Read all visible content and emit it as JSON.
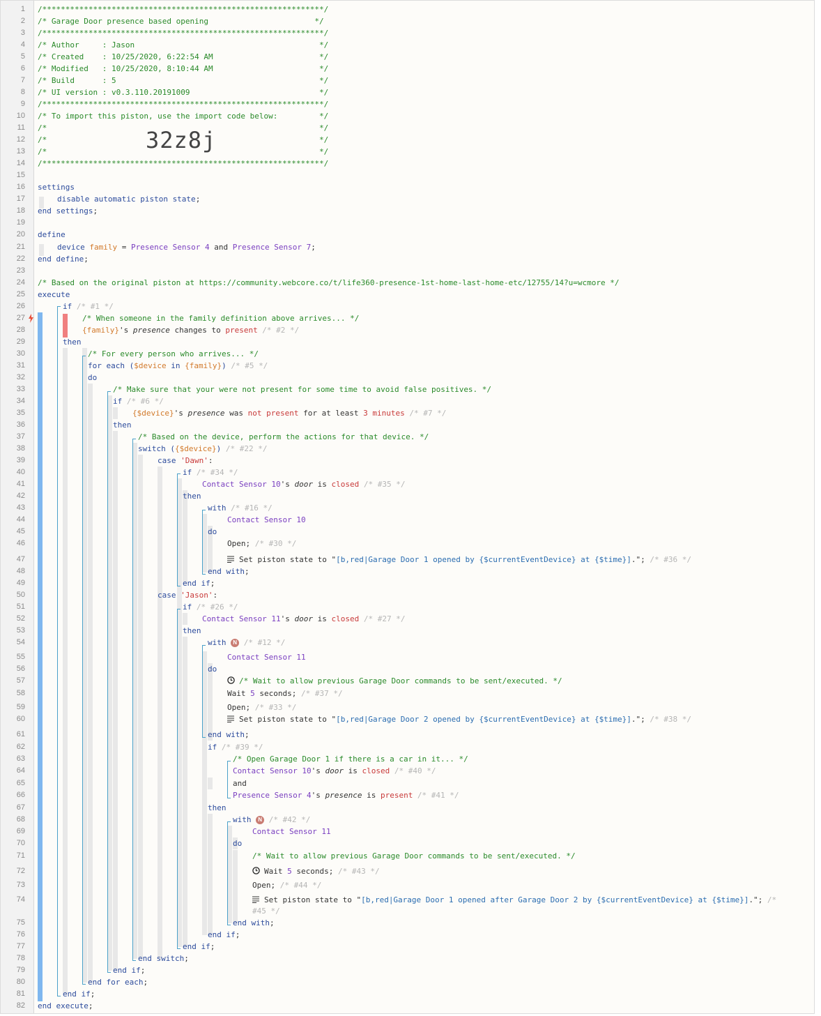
{
  "piston": {
    "title": "Garage Door presence based opening",
    "author": "Jason",
    "created": "10/25/2020, 6:22:54 AM",
    "modified": "10/25/2020, 8:10:44 AM",
    "build": "5",
    "ui_version": "v0.3.110.20191009",
    "import_code": "32z8j"
  },
  "icons": {
    "trigger": "lightning-bolt-icon",
    "wait": "clock-icon",
    "set_state": "list-icon",
    "with_badge": "n-badge-icon"
  },
  "colors": {
    "comment": "#2a8a2a",
    "keyword": "#2c4b9c",
    "device": "#7a3fc0",
    "variable": "#d27a2c",
    "string": "#2a6cb0",
    "value_red": "#c83a3a",
    "block_bar": "#7fb7ef",
    "trigger_bar": "#f08080"
  },
  "lines": [
    {
      "n": "1",
      "parts": [
        {
          "t": "/*************************************************************/",
          "c": "cmt"
        }
      ]
    },
    {
      "n": "2",
      "parts": [
        {
          "t": "/* Garage Door presence based opening                       */",
          "c": "cmt"
        }
      ]
    },
    {
      "n": "3",
      "parts": [
        {
          "t": "/*************************************************************/",
          "c": "cmt"
        }
      ]
    },
    {
      "n": "4",
      "parts": [
        {
          "t": "/* Author     : Jason                                        */",
          "c": "cmt"
        }
      ]
    },
    {
      "n": "5",
      "parts": [
        {
          "t": "/* Created    : 10/25/2020, 6:22:54 AM                       */",
          "c": "cmt"
        }
      ]
    },
    {
      "n": "6",
      "parts": [
        {
          "t": "/* Modified   : 10/25/2020, 8:10:44 AM                       */",
          "c": "cmt"
        }
      ]
    },
    {
      "n": "7",
      "parts": [
        {
          "t": "/* Build      : 5                                            */",
          "c": "cmt"
        }
      ]
    },
    {
      "n": "8",
      "parts": [
        {
          "t": "/* UI version : v0.3.110.20191009                            */",
          "c": "cmt"
        }
      ]
    },
    {
      "n": "9",
      "parts": [
        {
          "t": "/*************************************************************/",
          "c": "cmt"
        }
      ]
    },
    {
      "n": "10",
      "parts": [
        {
          "t": "/* To import this piston, use the import code below:         */",
          "c": "cmt"
        }
      ]
    },
    {
      "n": "11",
      "parts": [
        {
          "t": "/*                                                           */",
          "c": "cmt"
        }
      ]
    },
    {
      "n": "12",
      "parts": [
        {
          "t": "/*                                                           */",
          "c": "cmt"
        }
      ]
    },
    {
      "n": "13",
      "parts": [
        {
          "t": "/*                                                           */",
          "c": "cmt"
        }
      ]
    },
    {
      "n": "14",
      "parts": [
        {
          "t": "/*************************************************************/",
          "c": "cmt"
        }
      ]
    },
    {
      "n": "15",
      "parts": []
    },
    {
      "n": "16",
      "parts": [
        {
          "t": "settings",
          "c": "kw"
        }
      ]
    },
    {
      "n": "17",
      "parts": [
        {
          "t": "disable automatic piston state",
          "c": "kw"
        },
        {
          "t": ";",
          "c": "pl"
        }
      ]
    },
    {
      "n": "18",
      "parts": [
        {
          "t": "end settings",
          "c": "kw"
        },
        {
          "t": ";",
          "c": "pl"
        }
      ]
    },
    {
      "n": "19",
      "parts": []
    },
    {
      "n": "20",
      "parts": [
        {
          "t": "define",
          "c": "kw"
        }
      ]
    },
    {
      "n": "21",
      "parts": [
        {
          "t": "device ",
          "c": "kw"
        },
        {
          "t": "family",
          "c": "var"
        },
        {
          "t": " = ",
          "c": "pl"
        },
        {
          "t": "Presence Sensor 4",
          "c": "dev"
        },
        {
          "t": " and ",
          "c": "pl"
        },
        {
          "t": "Presence Sensor 7",
          "c": "dev"
        },
        {
          "t": ";",
          "c": "pl"
        }
      ]
    },
    {
      "n": "22",
      "parts": [
        {
          "t": "end define",
          "c": "kw"
        },
        {
          "t": ";",
          "c": "pl"
        }
      ]
    },
    {
      "n": "23",
      "parts": []
    },
    {
      "n": "24",
      "parts": [
        {
          "t": "/* Based on the original piston at https://community.webcore.co/t/life360-presence-1st-home-last-home-etc/12755/14?u=wcmore */",
          "c": "cmt"
        }
      ]
    },
    {
      "n": "25",
      "parts": [
        {
          "t": "execute",
          "c": "kw"
        }
      ]
    },
    {
      "n": "26",
      "parts": [
        {
          "t": "if ",
          "c": "kw"
        },
        {
          "t": "/* #1 */",
          "c": "dim"
        }
      ]
    },
    {
      "n": "27",
      "parts": [
        {
          "t": "/* When someone in the family definition above arrives... */",
          "c": "cmt"
        }
      ]
    },
    {
      "n": "28",
      "parts": [
        {
          "t": "{family}",
          "c": "var"
        },
        {
          "t": "'s ",
          "c": "pl"
        },
        {
          "t": "presence",
          "c": "pl it"
        },
        {
          "t": " changes to ",
          "c": "pl"
        },
        {
          "t": "present",
          "c": "red"
        },
        {
          "t": " /* #2 */",
          "c": "dim"
        }
      ]
    },
    {
      "n": "29",
      "parts": [
        {
          "t": "then",
          "c": "kw"
        }
      ]
    },
    {
      "n": "30",
      "parts": [
        {
          "t": "/* For every person who arrives... */",
          "c": "cmt"
        }
      ]
    },
    {
      "n": "31",
      "parts": [
        {
          "t": "for each (",
          "c": "kw"
        },
        {
          "t": "$device",
          "c": "var"
        },
        {
          "t": " in ",
          "c": "kw"
        },
        {
          "t": "{family}",
          "c": "var"
        },
        {
          "t": ") ",
          "c": "kw"
        },
        {
          "t": "/* #5 */",
          "c": "dim"
        }
      ]
    },
    {
      "n": "32",
      "parts": [
        {
          "t": "do",
          "c": "kw"
        }
      ]
    },
    {
      "n": "33",
      "parts": [
        {
          "t": "/* Make sure that your were not present for some time to avoid false positives. */",
          "c": "cmt"
        }
      ]
    },
    {
      "n": "34",
      "parts": [
        {
          "t": "if ",
          "c": "kw"
        },
        {
          "t": "/* #6 */",
          "c": "dim"
        }
      ]
    },
    {
      "n": "35",
      "parts": [
        {
          "t": "{$device}",
          "c": "var"
        },
        {
          "t": "'s ",
          "c": "pl"
        },
        {
          "t": "presence",
          "c": "pl it"
        },
        {
          "t": " was ",
          "c": "pl"
        },
        {
          "t": "not present",
          "c": "red"
        },
        {
          "t": " for at least ",
          "c": "pl"
        },
        {
          "t": "3 minutes",
          "c": "red"
        },
        {
          "t": " /* #7 */",
          "c": "dim"
        }
      ]
    },
    {
      "n": "36",
      "parts": [
        {
          "t": "then",
          "c": "kw"
        }
      ]
    },
    {
      "n": "37",
      "parts": [
        {
          "t": "/* Based on the device, perform the actions for that device. */",
          "c": "cmt"
        }
      ]
    },
    {
      "n": "38",
      "parts": [
        {
          "t": "switch (",
          "c": "kw"
        },
        {
          "t": "{$device}",
          "c": "var"
        },
        {
          "t": ") ",
          "c": "kw"
        },
        {
          "t": "/* #22 */",
          "c": "dim"
        }
      ]
    },
    {
      "n": "39",
      "parts": [
        {
          "t": "case ",
          "c": "kw"
        },
        {
          "t": "'Dawn'",
          "c": "red"
        },
        {
          "t": ":",
          "c": "pl"
        }
      ]
    },
    {
      "n": "40",
      "parts": [
        {
          "t": "if ",
          "c": "kw"
        },
        {
          "t": "/* #34 */",
          "c": "dim"
        }
      ]
    },
    {
      "n": "41",
      "parts": [
        {
          "t": "Contact Sensor 10",
          "c": "dev"
        },
        {
          "t": "'s ",
          "c": "pl"
        },
        {
          "t": "door",
          "c": "pl it"
        },
        {
          "t": " is ",
          "c": "pl"
        },
        {
          "t": "closed",
          "c": "red"
        },
        {
          "t": " /* #35 */",
          "c": "dim"
        }
      ]
    },
    {
      "n": "42",
      "parts": [
        {
          "t": "then",
          "c": "kw"
        }
      ]
    },
    {
      "n": "43",
      "parts": [
        {
          "t": "with ",
          "c": "kw"
        },
        {
          "t": "/* #16 */",
          "c": "dim"
        }
      ]
    },
    {
      "n": "44",
      "parts": [
        {
          "t": "Contact Sensor 10",
          "c": "dev"
        }
      ]
    },
    {
      "n": "45",
      "parts": [
        {
          "t": "do",
          "c": "kw"
        }
      ]
    },
    {
      "n": "46",
      "parts": [
        {
          "t": "Open; ",
          "c": "pl"
        },
        {
          "t": "/* #30 */",
          "c": "dim"
        }
      ]
    },
    {
      "n": "47",
      "parts": [
        {
          "t": "Set piston state to \"",
          "c": "pl"
        },
        {
          "t": "[b,red|Garage Door 1 opened by {$currentEventDevice} at {$time}]",
          "c": "str"
        },
        {
          "t": ".\"; ",
          "c": "pl"
        },
        {
          "t": "/* #36 */",
          "c": "dim"
        }
      ]
    },
    {
      "n": "48",
      "parts": [
        {
          "t": "end with",
          "c": "kw"
        },
        {
          "t": ";",
          "c": "pl"
        }
      ]
    },
    {
      "n": "49",
      "parts": [
        {
          "t": "end if",
          "c": "kw"
        },
        {
          "t": ";",
          "c": "pl"
        }
      ]
    },
    {
      "n": "50",
      "parts": [
        {
          "t": "case ",
          "c": "kw"
        },
        {
          "t": "'Jason'",
          "c": "red"
        },
        {
          "t": ":",
          "c": "pl"
        }
      ]
    },
    {
      "n": "51",
      "parts": [
        {
          "t": "if ",
          "c": "kw"
        },
        {
          "t": "/* #26 */",
          "c": "dim"
        }
      ]
    },
    {
      "n": "52",
      "parts": [
        {
          "t": "Contact Sensor 11",
          "c": "dev"
        },
        {
          "t": "'s ",
          "c": "pl"
        },
        {
          "t": "door",
          "c": "pl it"
        },
        {
          "t": " is ",
          "c": "pl"
        },
        {
          "t": "closed",
          "c": "red"
        },
        {
          "t": " /* #27 */",
          "c": "dim"
        }
      ]
    },
    {
      "n": "53",
      "parts": [
        {
          "t": "then",
          "c": "kw"
        }
      ]
    },
    {
      "n": "54",
      "parts": [
        {
          "t": "with ",
          "c": "kw"
        },
        {
          "t": "N",
          "c": "badge"
        },
        {
          "t": " /* #12 */",
          "c": "dim"
        }
      ]
    },
    {
      "n": "55",
      "parts": [
        {
          "t": "Contact Sensor 11",
          "c": "dev"
        }
      ]
    },
    {
      "n": "56",
      "parts": [
        {
          "t": "do",
          "c": "kw"
        }
      ]
    },
    {
      "n": "57",
      "parts": [
        {
          "t": "/* Wait to allow previous Garage Door commands to be sent/executed. */",
          "c": "cmt"
        }
      ]
    },
    {
      "n": "58",
      "parts": [
        {
          "t": "Wait ",
          "c": "pl"
        },
        {
          "t": "5",
          "c": "num"
        },
        {
          "t": " seconds; ",
          "c": "pl"
        },
        {
          "t": "/* #37 */",
          "c": "dim"
        }
      ]
    },
    {
      "n": "59",
      "parts": [
        {
          "t": "Open; ",
          "c": "pl"
        },
        {
          "t": "/* #33 */",
          "c": "dim"
        }
      ]
    },
    {
      "n": "60",
      "parts": [
        {
          "t": "Set piston state to \"",
          "c": "pl"
        },
        {
          "t": "[b,red|Garage Door 2 opened by {$currentEventDevice} at {$time}]",
          "c": "str"
        },
        {
          "t": ".\"; ",
          "c": "pl"
        },
        {
          "t": "/* #38 */",
          "c": "dim"
        }
      ]
    },
    {
      "n": "61",
      "parts": [
        {
          "t": "end with",
          "c": "kw"
        },
        {
          "t": ";",
          "c": "pl"
        }
      ]
    },
    {
      "n": "62",
      "parts": [
        {
          "t": "if ",
          "c": "kw"
        },
        {
          "t": "/* #39 */",
          "c": "dim"
        }
      ]
    },
    {
      "n": "63",
      "parts": [
        {
          "t": "/* Open Garage Door 1 if there is a car in it... */",
          "c": "cmt"
        }
      ]
    },
    {
      "n": "64",
      "parts": [
        {
          "t": "Contact Sensor 10",
          "c": "dev"
        },
        {
          "t": "'s ",
          "c": "pl"
        },
        {
          "t": "door",
          "c": "pl it"
        },
        {
          "t": " is ",
          "c": "pl"
        },
        {
          "t": "closed",
          "c": "red"
        },
        {
          "t": " /* #40 */",
          "c": "dim"
        }
      ]
    },
    {
      "n": "65",
      "parts": [
        {
          "t": "and",
          "c": "pl"
        }
      ]
    },
    {
      "n": "66",
      "parts": [
        {
          "t": "Presence Sensor 4",
          "c": "dev"
        },
        {
          "t": "'s ",
          "c": "pl"
        },
        {
          "t": "presence",
          "c": "pl it"
        },
        {
          "t": " is ",
          "c": "pl"
        },
        {
          "t": "present",
          "c": "red"
        },
        {
          "t": " /* #41 */",
          "c": "dim"
        }
      ]
    },
    {
      "n": "67",
      "parts": [
        {
          "t": "then",
          "c": "kw"
        }
      ]
    },
    {
      "n": "68",
      "parts": [
        {
          "t": "with ",
          "c": "kw"
        },
        {
          "t": "N",
          "c": "badge"
        },
        {
          "t": " /* #42 */",
          "c": "dim"
        }
      ]
    },
    {
      "n": "69",
      "parts": [
        {
          "t": "Contact Sensor 11",
          "c": "dev"
        }
      ]
    },
    {
      "n": "70",
      "parts": [
        {
          "t": "do",
          "c": "kw"
        }
      ]
    },
    {
      "n": "71",
      "parts": [
        {
          "t": "/* Wait to allow previous Garage Door commands to be sent/executed. */",
          "c": "cmt"
        }
      ]
    },
    {
      "n": "72",
      "parts": [
        {
          "t": "Wait ",
          "c": "pl"
        },
        {
          "t": "5",
          "c": "num"
        },
        {
          "t": " seconds; ",
          "c": "pl"
        },
        {
          "t": "/* #43 */",
          "c": "dim"
        }
      ]
    },
    {
      "n": "73",
      "parts": [
        {
          "t": "Open; ",
          "c": "pl"
        },
        {
          "t": "/* #44 */",
          "c": "dim"
        }
      ]
    },
    {
      "n": "74",
      "parts": [
        {
          "t": "Set piston state to \"",
          "c": "pl"
        },
        {
          "t": "[b,red|Garage Door 1 opened after Garage Door 2 by {$currentEventDevice} at {$time}]",
          "c": "str"
        },
        {
          "t": ".\"; ",
          "c": "pl"
        },
        {
          "t": "/*",
          "c": "dim"
        }
      ]
    },
    {
      "n": "",
      "parts": [
        {
          "t": "#45 */",
          "c": "dim"
        }
      ]
    },
    {
      "n": "75",
      "parts": [
        {
          "t": "end with",
          "c": "kw"
        },
        {
          "t": ";",
          "c": "pl"
        }
      ]
    },
    {
      "n": "76",
      "parts": [
        {
          "t": "end if",
          "c": "kw"
        },
        {
          "t": ";",
          "c": "pl"
        }
      ]
    },
    {
      "n": "77",
      "parts": [
        {
          "t": "end if",
          "c": "kw"
        },
        {
          "t": ";",
          "c": "pl"
        }
      ]
    },
    {
      "n": "78",
      "parts": [
        {
          "t": "end switch",
          "c": "kw"
        },
        {
          "t": ";",
          "c": "pl"
        }
      ]
    },
    {
      "n": "79",
      "parts": [
        {
          "t": "end if",
          "c": "kw"
        },
        {
          "t": ";",
          "c": "pl"
        }
      ]
    },
    {
      "n": "80",
      "parts": [
        {
          "t": "end for each",
          "c": "kw"
        },
        {
          "t": ";",
          "c": "pl"
        }
      ]
    },
    {
      "n": "81",
      "parts": [
        {
          "t": "end if",
          "c": "kw"
        },
        {
          "t": ";",
          "c": "pl"
        }
      ]
    },
    {
      "n": "82",
      "parts": [
        {
          "t": "end execute",
          "c": "kw"
        },
        {
          "t": ";",
          "c": "pl"
        }
      ]
    }
  ]
}
